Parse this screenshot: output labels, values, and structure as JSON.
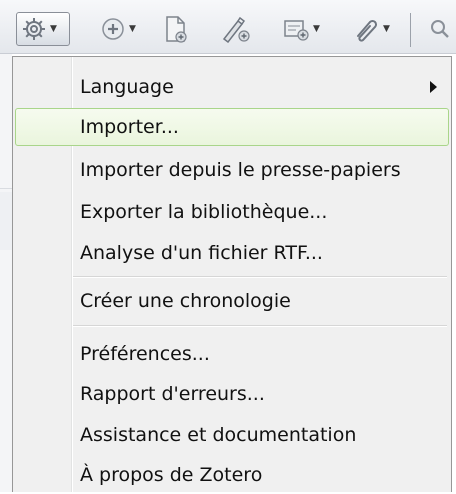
{
  "toolbar": {
    "buttons": [
      {
        "icon": "gear-icon",
        "has_dropdown": true
      },
      {
        "icon": "add-icon",
        "has_dropdown": true
      },
      {
        "icon": "new-item-icon",
        "has_dropdown": false
      },
      {
        "icon": "attach-link-icon",
        "has_dropdown": false
      },
      {
        "icon": "new-note-icon",
        "has_dropdown": true
      },
      {
        "icon": "paperclip-icon",
        "has_dropdown": true
      },
      {
        "icon": "search-icon",
        "has_dropdown": false
      }
    ]
  },
  "menu": {
    "items": [
      {
        "label": "Language",
        "has_submenu": true
      },
      {
        "label": "Importer...",
        "hovered": true
      },
      {
        "label": "Importer depuis le presse-papiers"
      },
      {
        "label": "Exporter la bibliothèque..."
      },
      {
        "label": "Analyse d'un fichier RTF..."
      },
      {
        "label": "Créer une chronologie"
      },
      {
        "label": "Préférences..."
      },
      {
        "label": "Rapport d'erreurs..."
      },
      {
        "label": "Assistance et documentation"
      },
      {
        "label": "À propos de Zotero"
      }
    ]
  },
  "colors": {
    "hover_border": "#a9d58a",
    "menu_background": "#f0f0f0",
    "toolbar_background": "#e4e7ec"
  }
}
